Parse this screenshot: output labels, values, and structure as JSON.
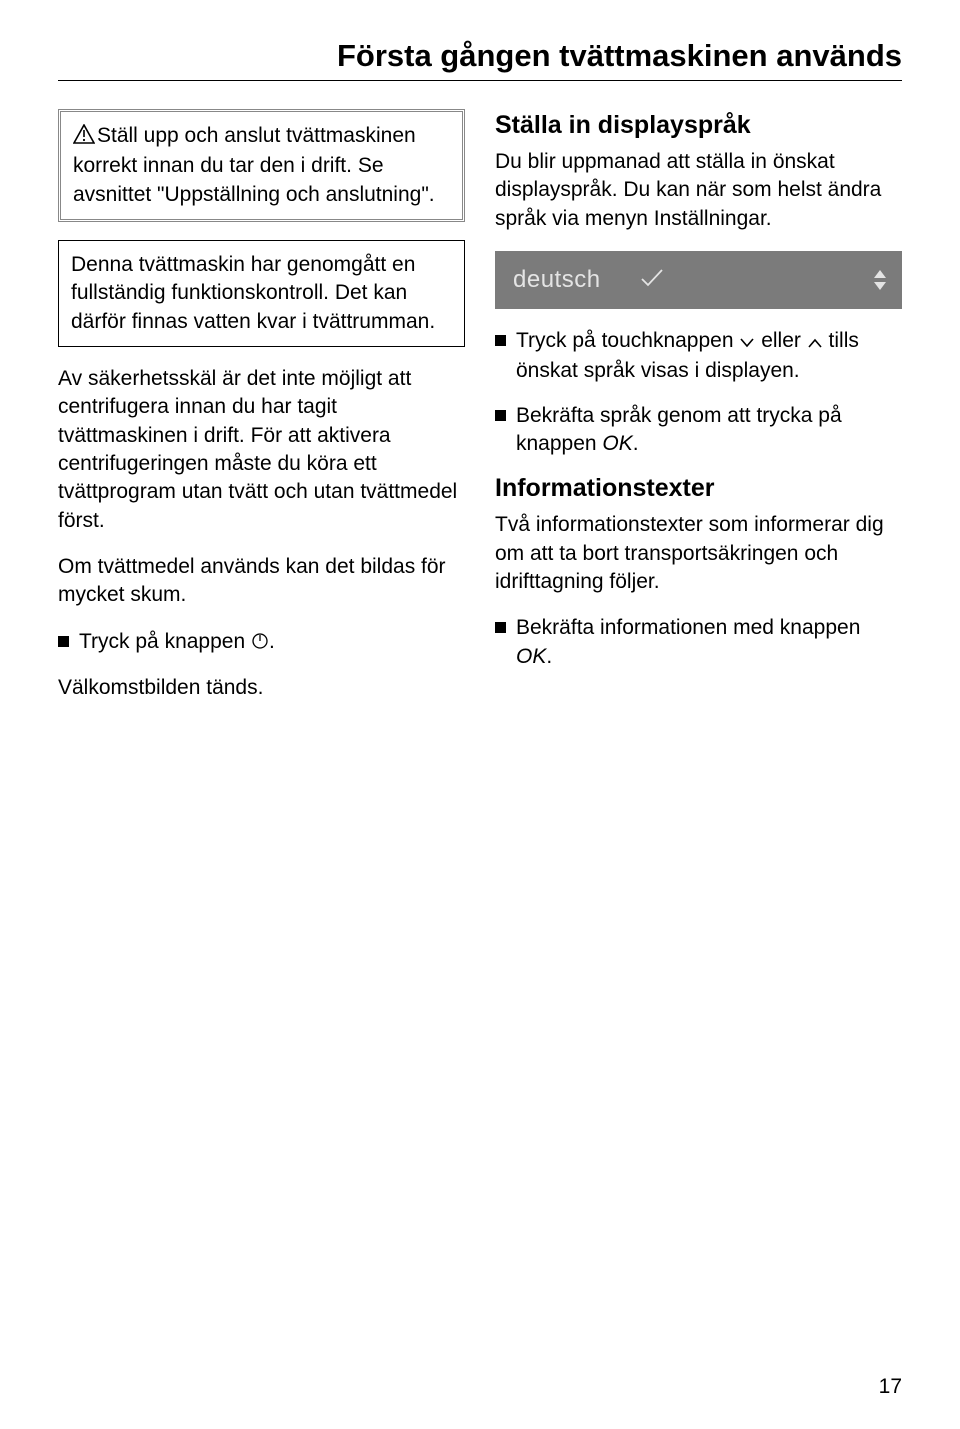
{
  "title": "Första gången tvättmaskinen används",
  "left": {
    "warning": "Ställ upp och anslut tvättmaskinen korrekt innan du tar den i drift. Se avsnittet \"Uppställning och anslutning\".",
    "infobox": "Denna tvättmaskin har genomgått en fullständig funktionskontroll. Det kan därför finnas vatten kvar i tvättrumman.",
    "safety": "Av säkerhetsskäl är det inte möjligt att centrifugera innan du har tagit tvättmaskinen i drift. För att aktivera centrifugeringen måste du köra ett tvättprogram utan tvätt och utan tvättmedel först.",
    "foam": "Om tvättmedel används kan det bildas för mycket skum.",
    "press_button_pre": "Tryck på knappen ",
    "press_button_post": ".",
    "welcome": "Välkomstbilden tänds."
  },
  "right": {
    "heading1": "Ställa in displayspråk",
    "lang_intro": "Du blir uppmanad att ställa in önskat displayspråk. Du kan när som helst ändra språk via menyn Inställningar.",
    "display_label": "deutsch",
    "press_touch_pre": "Tryck på touchknappen ",
    "press_touch_mid": " eller ",
    "press_touch_post": " tills önskat språk visas i displayen.",
    "confirm_lang_pre": "Bekräfta språk genom att trycka på knappen ",
    "confirm_lang_ok": "OK",
    "confirm_lang_post": ".",
    "heading2": "Informationstexter",
    "info_texts": "Två informationstexter som informerar dig om att ta bort transportsäkringen och idrifttagning följer.",
    "confirm_info_pre": "Bekräfta informationen med knappen ",
    "confirm_info_ok": "OK",
    "confirm_info_post": "."
  },
  "page_number": "17"
}
